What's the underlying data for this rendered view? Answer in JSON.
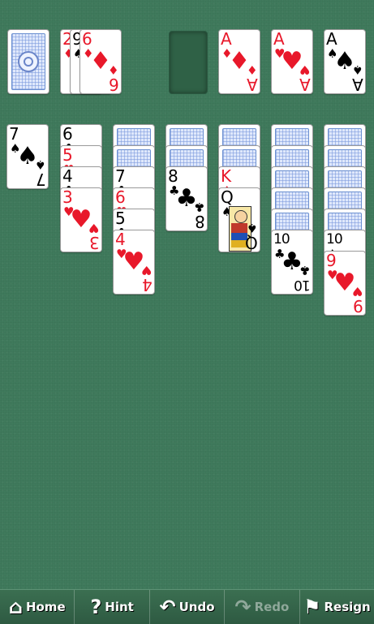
{
  "stock": {
    "label": "stock"
  },
  "waste": [
    {
      "rank": "2",
      "suit": "♦",
      "color": "red"
    },
    {
      "rank": "9",
      "suit": "♠",
      "color": "black"
    },
    {
      "rank": "6",
      "suit": "♦",
      "color": "red"
    }
  ],
  "foundations": [
    {
      "empty": true
    },
    {
      "rank": "A",
      "suit": "♦",
      "color": "red"
    },
    {
      "rank": "A",
      "suit": "♥",
      "color": "red"
    },
    {
      "rank": "A",
      "suit": "♠",
      "color": "black"
    }
  ],
  "tableau": [
    {
      "face_down": 0,
      "cards": [
        {
          "rank": "7",
          "suit": "♠",
          "color": "black"
        }
      ]
    },
    {
      "face_down": 0,
      "cards": [
        {
          "rank": "6",
          "suit": "♣",
          "color": "black"
        },
        {
          "rank": "5",
          "suit": "♥",
          "color": "red"
        },
        {
          "rank": "4",
          "suit": "♣",
          "color": "black"
        },
        {
          "rank": "3",
          "suit": "♥",
          "color": "red"
        }
      ]
    },
    {
      "face_down": 2,
      "cards": [
        {
          "rank": "7",
          "suit": "♣",
          "color": "black"
        },
        {
          "rank": "6",
          "suit": "♥",
          "color": "red"
        },
        {
          "rank": "5",
          "suit": "♣",
          "color": "black"
        },
        {
          "rank": "4",
          "suit": "♥",
          "color": "red"
        }
      ]
    },
    {
      "face_down": 2,
      "cards": [
        {
          "rank": "8",
          "suit": "♣",
          "color": "black"
        }
      ]
    },
    {
      "face_down": 2,
      "cards": [
        {
          "rank": "K",
          "suit": "♦",
          "color": "red"
        },
        {
          "rank": "Q",
          "suit": "♠",
          "color": "black"
        }
      ]
    },
    {
      "face_down": 5,
      "cards": [
        {
          "rank": "10",
          "suit": "♣",
          "color": "black"
        }
      ]
    },
    {
      "face_down": 5,
      "cards": [
        {
          "rank": "10",
          "suit": "♠",
          "color": "black"
        },
        {
          "rank": "9",
          "suit": "♥",
          "color": "red"
        }
      ]
    }
  ],
  "toolbar": {
    "home": "Home",
    "hint": "Hint",
    "undo": "Undo",
    "redo": "Redo",
    "resign": "Resign"
  }
}
